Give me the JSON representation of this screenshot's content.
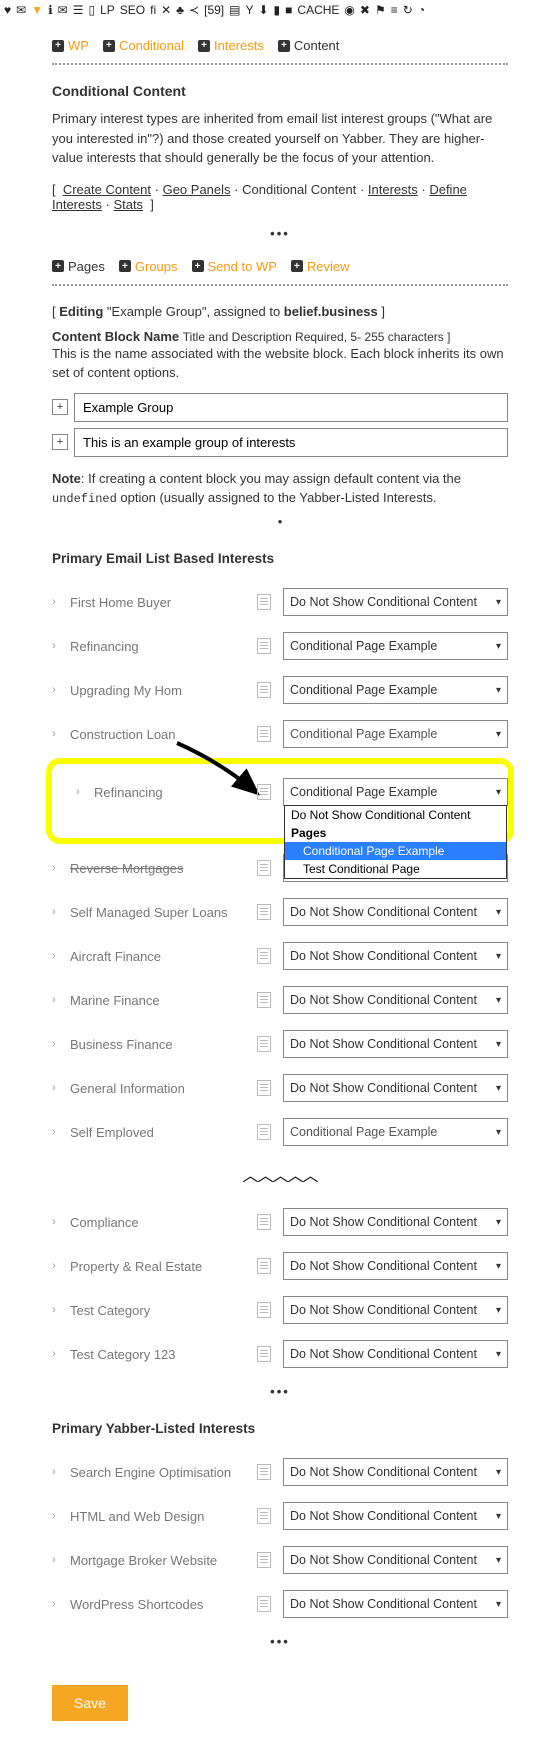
{
  "toolbar_badge": "[59]",
  "toolbar_lp": "LP",
  "toolbar_seo": "SEO",
  "toolbar_cache": "CACHE",
  "tabs_top": {
    "wp": "WP",
    "conditional": "Conditional",
    "interests": "Interests",
    "content": "Content"
  },
  "header": {
    "title": "Conditional Content",
    "desc": "Primary interest types are inherited from email list interest groups (\"What are you interested in\"?) and those created yourself on Yabber. They are higher-value interests that should generally be the focus of your attention."
  },
  "breadcrumb": {
    "items": [
      "Create Content",
      "Geo Panels",
      "Conditional Content",
      "Interests",
      "Define Interests",
      "Stats"
    ],
    "current_index": 2
  },
  "tabs_mid": {
    "pages": "Pages",
    "groups": "Groups",
    "send": "Send to WP",
    "review": "Review"
  },
  "editing": {
    "pre": "Editing",
    "quote": "\"Example Group\", assigned to",
    "target": "belief.business"
  },
  "block": {
    "label": "Content Block Name",
    "req": "Title and Description Required, 5- 255 characters ]",
    "desc": "This is the name associated with the website block. Each block inherits its own set of content options.",
    "title_value": "Example Group",
    "desc_value": "This is an example group of interests"
  },
  "note": {
    "b": "Note",
    "text1": ": If creating a content block you may assign default content via the ",
    "code": "undefined",
    "text2": " option (usually assigned to the Yabber-Listed Interests."
  },
  "sections": {
    "primary": "Primary Email List Based Interests",
    "yabber": "Primary Yabber-Listed Interests"
  },
  "opt_default": "Do Not Show Conditional Content",
  "opt_cpe": "Conditional Page Example",
  "primary_rows": [
    {
      "label": "First Home Buyer",
      "value": "Do Not Show Conditional Content"
    },
    {
      "label": "Refinancing",
      "value": "Conditional Page Example"
    },
    {
      "label": "Upgrading My Hom",
      "value": "Conditional Page Example"
    },
    {
      "label": "Construction Loan",
      "value": "Conditional Page Example",
      "cutoff": true
    }
  ],
  "highlight": {
    "label": "Refinancing",
    "selected": "Conditional Page Example",
    "options": [
      {
        "label": "Do Not Show Conditional Content",
        "group": false,
        "indent": false,
        "sel": false
      },
      {
        "label": "Pages",
        "group": true,
        "indent": false,
        "sel": false
      },
      {
        "label": "Conditional Page Example",
        "group": false,
        "indent": true,
        "sel": true
      },
      {
        "label": "Test Conditional Page",
        "group": false,
        "indent": true,
        "sel": false
      }
    ]
  },
  "primary_rows2": [
    {
      "label": "Reverse Mortgages",
      "value": "Do Not Show Conditional Content",
      "strike": true
    },
    {
      "label": "Self Managed Super Loans",
      "value": "Do Not Show Conditional Content"
    },
    {
      "label": "Aircraft Finance",
      "value": "Do Not Show Conditional Content"
    },
    {
      "label": "Marine Finance",
      "value": "Do Not Show Conditional Content"
    },
    {
      "label": "Business Finance",
      "value": "Do Not Show Conditional Content"
    },
    {
      "label": "General Information",
      "value": "Do Not Show Conditional Content"
    },
    {
      "label": "Self Emploved",
      "value": "Conditional Page Example",
      "cutoff": true
    }
  ],
  "primary_rows3": [
    {
      "label": "Compliance",
      "value": "Do Not Show Conditional Content"
    },
    {
      "label": "Property & Real Estate",
      "value": "Do Not Show Conditional Content"
    },
    {
      "label": "Test Category",
      "value": "Do Not Show Conditional Content"
    },
    {
      "label": "Test Category 123",
      "value": "Do Not Show Conditional Content"
    }
  ],
  "yabber_rows": [
    {
      "label": "Search Engine Optimisation",
      "value": "Do Not Show Conditional Content"
    },
    {
      "label": "HTML and Web Design",
      "value": "Do Not Show Conditional Content"
    },
    {
      "label": "Mortgage Broker Website",
      "value": "Do Not Show Conditional Content"
    },
    {
      "label": "WordPress Shortcodes",
      "value": "Do Not Show Conditional Content"
    }
  ],
  "save": "Save"
}
